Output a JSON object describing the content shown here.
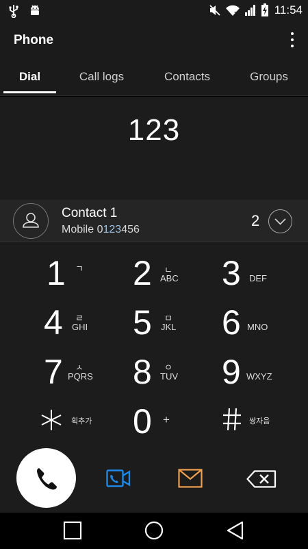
{
  "status_bar": {
    "time": "11:54",
    "icons": [
      "usb-icon",
      "android-debug-icon",
      "mute-icon",
      "wifi-icon",
      "signal-icon",
      "battery-charging-icon"
    ]
  },
  "app_bar": {
    "title": "Phone"
  },
  "tabs": [
    {
      "label": "Dial",
      "active": true
    },
    {
      "label": "Call logs",
      "active": false
    },
    {
      "label": "Contacts",
      "active": false
    },
    {
      "label": "Groups",
      "active": false
    }
  ],
  "dialed_number": "123",
  "contact_suggestion": {
    "name": "Contact 1",
    "type_label": "Mobile",
    "number_pre": "0",
    "number_match": "123",
    "number_post": "456",
    "match_count": "2"
  },
  "keypad": {
    "keys": [
      {
        "digit": "1",
        "korean": "ㄱ",
        "letters": ""
      },
      {
        "digit": "2",
        "korean": "ㄴ",
        "letters": "ABC"
      },
      {
        "digit": "3",
        "korean": "",
        "letters": "DEF"
      },
      {
        "digit": "4",
        "korean": "ㄹ",
        "letters": "GHI"
      },
      {
        "digit": "5",
        "korean": "ㅁ",
        "letters": "JKL"
      },
      {
        "digit": "6",
        "korean": "",
        "letters": "MNO"
      },
      {
        "digit": "7",
        "korean": "ㅅ",
        "letters": "PQRS"
      },
      {
        "digit": "8",
        "korean": "ㅇ",
        "letters": "TUV"
      },
      {
        "digit": "9",
        "korean": "",
        "letters": "WXYZ"
      },
      {
        "digit": "*",
        "korean": "",
        "letters": "획추가"
      },
      {
        "digit": "0",
        "korean": "",
        "letters": "+"
      },
      {
        "digit": "#",
        "korean": "",
        "letters": "쌍자음"
      }
    ]
  },
  "colors": {
    "video_call": "#1e88e5",
    "message": "#f0a050",
    "match_highlight": "#9fc3e6"
  }
}
